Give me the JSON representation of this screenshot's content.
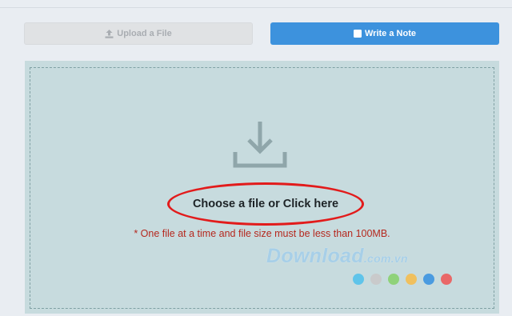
{
  "tabs": {
    "upload_label": "Upload a File",
    "upload_icon": "upload-icon",
    "note_label": "Write a Note",
    "note_icon": "note-icon"
  },
  "drop_zone": {
    "icon": "download-icon",
    "choose_label": "Choose a file or Click here",
    "note": "* One file at a time and file size must be less than 100MB."
  },
  "watermark": {
    "text": "Download",
    "suffix": ".com.vn",
    "dot_colors": [
      "#5fc4ea",
      "#c9cacb",
      "#8fd27a",
      "#f0c05e",
      "#4a9be0",
      "#e96868"
    ]
  },
  "colors": {
    "accent": "#3d92dd",
    "drop_bg": "#c7dbde",
    "note_red": "#b5281e",
    "highlight_red": "#e21b1b"
  }
}
